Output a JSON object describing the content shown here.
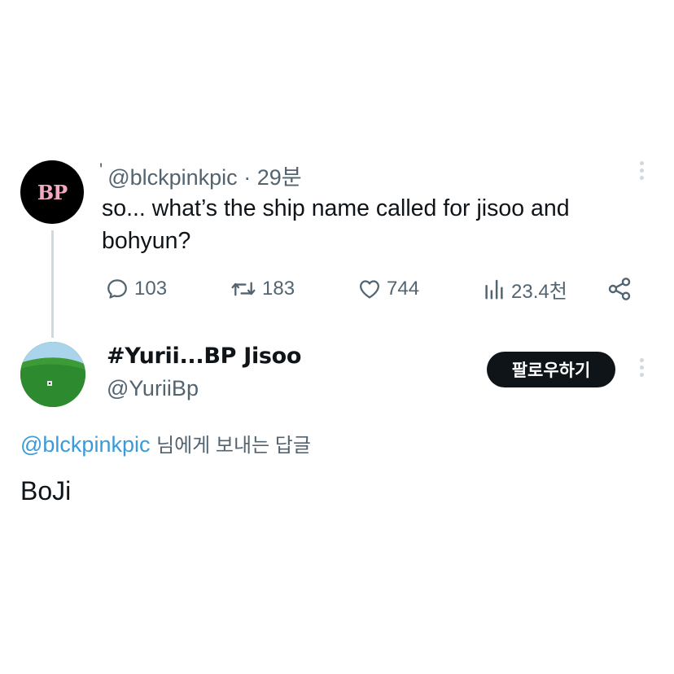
{
  "parent_tweet": {
    "avatar_text": "BP",
    "tick": "'",
    "handle": "@blckpinkpic",
    "separator": "·",
    "time": "29분",
    "text": "so... what’s the ship name called for jisoo and bohyun?",
    "actions": {
      "replies": "103",
      "retweets": "183",
      "likes": "744",
      "views": "23.4천"
    }
  },
  "reply_tweet": {
    "display_name": "#Yurii...BP Jisoo",
    "handle": "@YuriiBp",
    "follow_label": "팔로우하기",
    "replying_to_mention": "@blckpinkpic",
    "replying_to_suffix": "님에게 보내는 답글",
    "text": "BoJi"
  },
  "icons": {
    "reply": "reply-icon",
    "retweet": "retweet-icon",
    "like": "heart-icon",
    "views": "views-icon",
    "share": "share-icon",
    "more": "more-vertical-icon"
  },
  "colors": {
    "text_primary": "#0f1419",
    "text_secondary": "#536471",
    "mention": "#3b9ad8",
    "follow_button": "#0f1419"
  }
}
